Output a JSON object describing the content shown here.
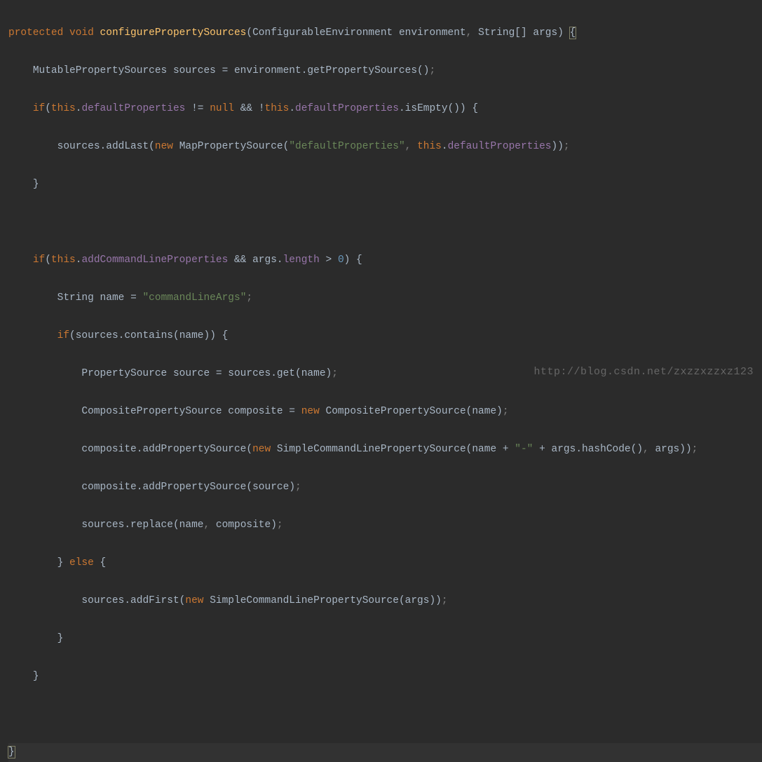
{
  "code": {
    "line1": {
      "modifier": "protected",
      "void": "void",
      "method_name": "configurePropertySources",
      "param1_type": "ConfigurableEnvironment",
      "param1_name": "environment",
      "param2_type": "String[]",
      "param2_name": "args",
      "brace": "{"
    },
    "line2": {
      "type": "MutablePropertySources",
      "var": "sources",
      "rhs_obj": "environment",
      "rhs_method": "getPropertySources"
    },
    "line3": {
      "if": "if",
      "this": "this",
      "field1": "defaultProperties",
      "null": "null",
      "this2": "this",
      "field2": "defaultProperties",
      "isEmpty": "isEmpty"
    },
    "line4": {
      "sources": "sources",
      "addLast": "addLast",
      "new": "new",
      "MapPropertySource": "MapPropertySource",
      "str": "\"defaultProperties\"",
      "this": "this",
      "field": "defaultProperties"
    },
    "line5": {
      "brace": "}"
    },
    "line7": {
      "if": "if",
      "this": "this",
      "field": "addCommandLineProperties",
      "args": "args",
      "length": "length",
      "zero": "0"
    },
    "line8": {
      "type": "String",
      "var": "name",
      "str": "\"commandLineArgs\""
    },
    "line9": {
      "if": "if",
      "sources": "sources",
      "contains": "contains",
      "name": "name"
    },
    "line10": {
      "type": "PropertySource",
      "var": "source",
      "sources": "sources",
      "get": "get",
      "name": "name"
    },
    "line11": {
      "type": "CompositePropertySource",
      "var": "composite",
      "new": "new",
      "ctor": "CompositePropertySource",
      "name": "name"
    },
    "line12": {
      "composite": "composite",
      "addPropertySource": "addPropertySource",
      "new": "new",
      "ctor": "SimpleCommandLinePropertySource",
      "name": "name",
      "dash_str": "\"-\"",
      "args": "args",
      "hashCode": "hashCode",
      "args2": "args"
    },
    "line13": {
      "composite": "composite",
      "addPropertySource": "addPropertySource",
      "source": "source"
    },
    "line14": {
      "sources": "sources",
      "replace": "replace",
      "name": "name",
      "composite": "composite"
    },
    "line15": {
      "brace": "}",
      "else": "else",
      "brace2": "{"
    },
    "line16": {
      "sources": "sources",
      "addFirst": "addFirst",
      "new": "new",
      "ctor": "SimpleCommandLinePropertySource",
      "args": "args"
    },
    "line17": {
      "brace": "}"
    },
    "line18": {
      "brace": "}"
    },
    "line20": {
      "brace": "}"
    }
  },
  "watermark": "http://blog.csdn.net/zxzzxzzxz123"
}
